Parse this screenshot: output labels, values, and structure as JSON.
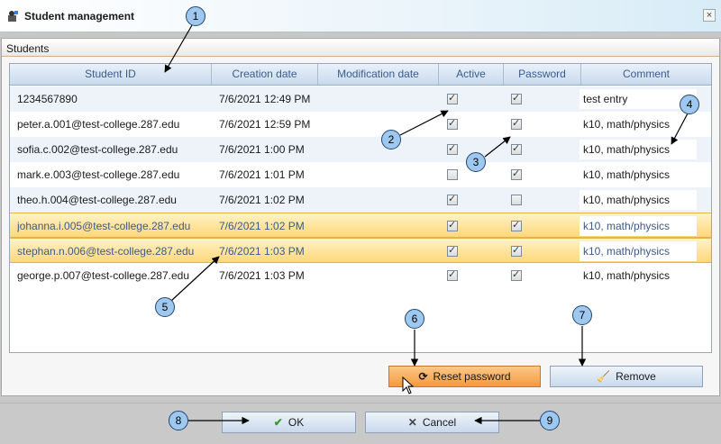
{
  "window": {
    "title": "Student management",
    "close_glyph": "×",
    "icon": "student-app-icon"
  },
  "group": {
    "title": "Students"
  },
  "grid": {
    "columns": [
      "Student ID",
      "Creation date",
      "Modification date",
      "Active",
      "Password",
      "Comment"
    ],
    "rows": [
      {
        "student_id": "1234567890",
        "creation_date": "7/6/2021 12:49 PM",
        "modification_date": "",
        "active": true,
        "password": true,
        "comment": "test entry",
        "selected": false
      },
      {
        "student_id": "peter.a.001@test-college.287.edu",
        "creation_date": "7/6/2021 12:59 PM",
        "modification_date": "",
        "active": true,
        "password": true,
        "comment": "k10, math/physics",
        "selected": false
      },
      {
        "student_id": "sofia.c.002@test-college.287.edu",
        "creation_date": "7/6/2021 1:00 PM",
        "modification_date": "",
        "active": true,
        "password": true,
        "comment": "k10, math/physics",
        "selected": false
      },
      {
        "student_id": "mark.e.003@test-college.287.edu",
        "creation_date": "7/6/2021 1:01 PM",
        "modification_date": "",
        "active": false,
        "password": true,
        "comment": "k10, math/physics",
        "selected": false
      },
      {
        "student_id": "theo.h.004@test-college.287.edu",
        "creation_date": "7/6/2021 1:02 PM",
        "modification_date": "",
        "active": true,
        "password": false,
        "comment": "k10, math/physics",
        "selected": false
      },
      {
        "student_id": "johanna.i.005@test-college.287.edu",
        "creation_date": "7/6/2021 1:02 PM",
        "modification_date": "",
        "active": true,
        "password": true,
        "comment": "k10, math/physics",
        "selected": true
      },
      {
        "student_id": "stephan.n.006@test-college.287.edu",
        "creation_date": "7/6/2021 1:03 PM",
        "modification_date": "",
        "active": true,
        "password": true,
        "comment": "k10, math/physics",
        "selected": true
      },
      {
        "student_id": "george.p.007@test-college.287.edu",
        "creation_date": "7/6/2021 1:03 PM",
        "modification_date": "",
        "active": true,
        "password": true,
        "comment": "k10, math/physics",
        "selected": false
      }
    ]
  },
  "actions": {
    "reset_password_label": "Reset password",
    "reset_password_icon": "refresh-icon",
    "remove_label": "Remove",
    "remove_icon": "broom-icon"
  },
  "dialog_buttons": {
    "ok_label": "OK",
    "ok_icon": "checkmark-icon",
    "cancel_label": "Cancel",
    "cancel_icon": "x-icon"
  },
  "callouts": [
    "1",
    "2",
    "3",
    "4",
    "5",
    "6",
    "7",
    "8",
    "9"
  ],
  "colors": {
    "selected_row": "#ffd77a",
    "header_text": "#3b5d8c",
    "orange_button": "#f39a3c",
    "callout_fill": "#9ec8f0"
  }
}
